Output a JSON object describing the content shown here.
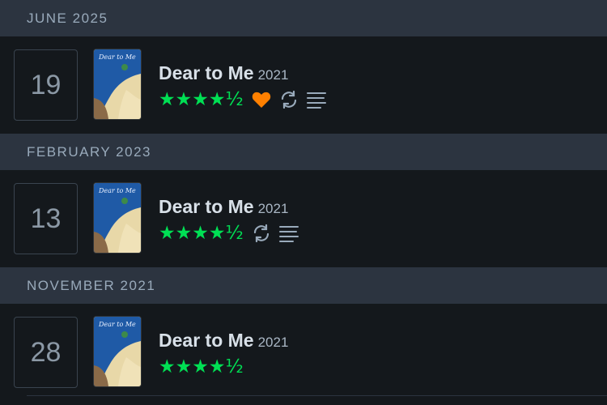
{
  "colors": {
    "background": "#14181c",
    "header_background": "#2c3440",
    "star_green": "#00e054",
    "heart_orange": "#ff8000",
    "icon_gray": "#9ab"
  },
  "months": [
    {
      "label": "JUNE 2025",
      "entry": {
        "day": "19",
        "title": "Dear to Me",
        "year": "2021",
        "stars": "★★★★½",
        "rating": 4.5,
        "liked": true,
        "rewatch": true,
        "review": true,
        "poster_text": "Dear to Me"
      }
    },
    {
      "label": "FEBRUARY 2023",
      "entry": {
        "day": "13",
        "title": "Dear to Me",
        "year": "2021",
        "stars": "★★★★½",
        "rating": 4.5,
        "liked": false,
        "rewatch": true,
        "review": true,
        "poster_text": "Dear to Me"
      }
    },
    {
      "label": "NOVEMBER 2021",
      "entry": {
        "day": "28",
        "title": "Dear to Me",
        "year": "2021",
        "stars": "★★★★½",
        "rating": 4.5,
        "liked": false,
        "rewatch": false,
        "review": false,
        "poster_text": "Dear to Me"
      }
    }
  ]
}
